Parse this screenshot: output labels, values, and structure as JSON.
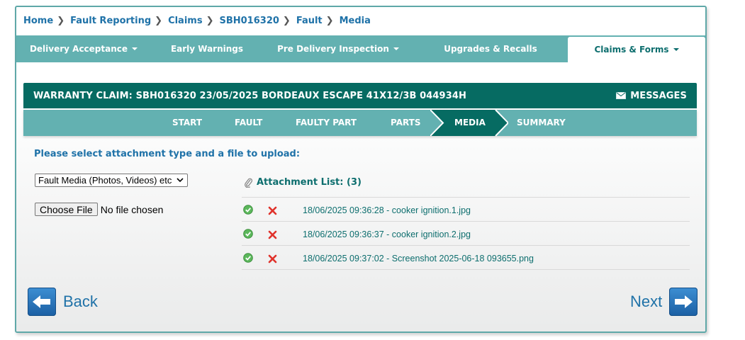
{
  "breadcrumb": {
    "items": [
      "Home",
      "Fault Reporting",
      "Claims",
      "SBH016320",
      "Fault",
      "Media"
    ]
  },
  "nav": {
    "items": [
      {
        "label": "Delivery Acceptance",
        "dropdown": true
      },
      {
        "label": "Early Warnings",
        "dropdown": false
      },
      {
        "label": "Pre Delivery Inspection",
        "dropdown": true
      },
      {
        "label": "Upgrades & Recalls",
        "dropdown": false
      },
      {
        "label": "Claims & Forms",
        "dropdown": true,
        "active": true
      }
    ]
  },
  "claim": {
    "title": "WARRANTY CLAIM: SBH016320 23/05/2025 BORDEAUX ESCAPE 41X12/3B 044934H",
    "messages_label": "MESSAGES"
  },
  "steps": {
    "items": [
      "START",
      "FAULT",
      "FAULTY PART",
      "PARTS",
      "MEDIA",
      "SUMMARY"
    ],
    "active": "MEDIA"
  },
  "upload": {
    "instruction": "Please select attachment type and a file to upload:",
    "type_selected": "Fault Media (Photos, Videos) etc",
    "choose_label": "Choose File",
    "no_file_text": "No file chosen"
  },
  "attachments": {
    "title": "Attachment List: (3)",
    "items": [
      {
        "text": "18/06/2025 09:36:28 - cooker ignition.1.jpg"
      },
      {
        "text": "18/06/2025 09:36:37 - cooker ignition.2.jpg"
      },
      {
        "text": "18/06/2025 09:37:02 - Screenshot 2025-06-18 093655.png"
      }
    ]
  },
  "footer": {
    "back_label": "Back",
    "next_label": "Next"
  },
  "colors": {
    "nav_teal": "#63b1b1",
    "header_dark_teal": "#066b62",
    "link_blue": "#1f72a8",
    "text_teal": "#0d6e6e"
  }
}
